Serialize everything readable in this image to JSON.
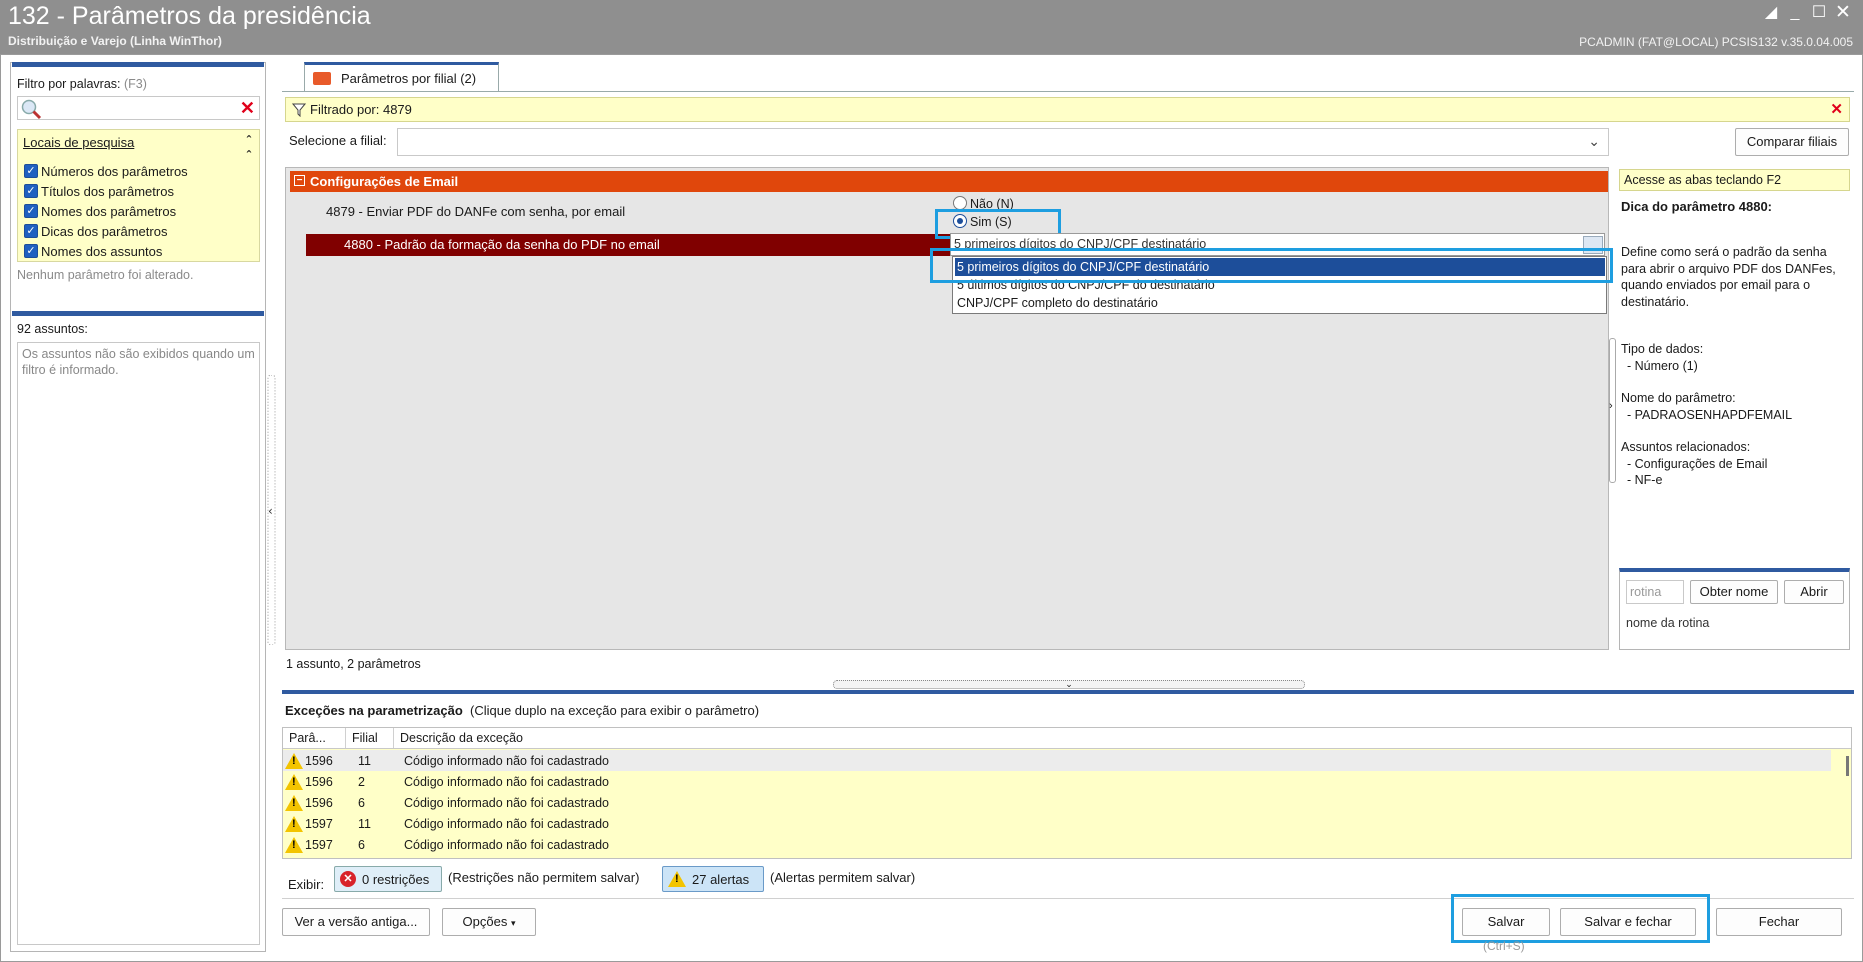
{
  "window": {
    "title": "132 - Parâmetros da presidência",
    "subtitle": "Distribuição e Varejo (Linha WinThor)",
    "user_info": "PCADMIN (FAT@LOCAL)   PCSIS132  v.35.0.04.005"
  },
  "left_panel": {
    "filter_label": "Filtro por palavras:",
    "filter_hint": "(F3)",
    "search_value": "",
    "locais_title": "Locais de pesquisa",
    "locais": [
      "Números dos parâmetros",
      "Títulos dos parâmetros",
      "Nomes dos parâmetros",
      "Dicas dos parâmetros",
      "Nomes dos assuntos"
    ],
    "no_change": "Nenhum parâmetro foi alterado.",
    "assuntos_count": "92 assuntos:",
    "assuntos_msg": "Os assuntos não são exibidos quando um filtro é informado."
  },
  "tab": {
    "label": "Parâmetros por filial  (2)"
  },
  "filter_bar": {
    "text": "Filtrado por: 4879"
  },
  "filial": {
    "label": "Selecione a filial:",
    "value": "",
    "compare_button": "Comparar filiais"
  },
  "section": {
    "title": "Configurações de Email"
  },
  "params": [
    {
      "label": "4879 - Enviar PDF do DANFe com senha, por email"
    },
    {
      "label": "4880 - Padrão da formação da senha do PDF no email"
    }
  ],
  "radio_options": {
    "nao": "Não (N)",
    "sim": "Sim (S)"
  },
  "combo": {
    "current": "5 primeiros dígitos do CNPJ/CPF destinatário",
    "options": [
      "5 primeiros dígitos do CNPJ/CPF destinatário",
      "5 últimos dígitos do CNPJ/CPF do destinatário",
      "CNPJ/CPF completo do destinatário"
    ]
  },
  "status": {
    "count": "1 assunto, 2 parâmetros"
  },
  "tips": {
    "access": "Acesse as abas teclando F2",
    "title": "Dica do parâmetro 4880:",
    "text": "Define como será o padrão da senha para abrir o arquivo PDF dos DANFes, quando enviados por email para o destinatário.",
    "tipo_label": "Tipo de dados:",
    "tipo_value": "- Número (1)",
    "nome_label": "Nome do parâmetro:",
    "nome_value": "- PADRAOSENHAPDFEMAIL",
    "assuntos_label": "Assuntos relacionados:",
    "assunto_1": "- Configurações de Email",
    "assunto_2": "- NF-e"
  },
  "routine": {
    "placeholder": "rotina",
    "obter_button": "Obter nome",
    "abrir_button": "Abrir",
    "name_label": "nome da rotina"
  },
  "exceptions": {
    "title": "Exceções na parametrização",
    "subtitle": "(Clique duplo na exceção para exibir o parâmetro)",
    "columns": [
      "Parâ...",
      "Filial",
      "Descrição da exceção"
    ],
    "rows": [
      {
        "param": "1596",
        "filial": "11",
        "desc": "Código informado não foi cadastrado"
      },
      {
        "param": "1596",
        "filial": "2",
        "desc": "Código informado não foi cadastrado"
      },
      {
        "param": "1596",
        "filial": "6",
        "desc": "Código informado não foi cadastrado"
      },
      {
        "param": "1597",
        "filial": "11",
        "desc": "Código informado não foi cadastrado"
      },
      {
        "param": "1597",
        "filial": "6",
        "desc": "Código informado não foi cadastrado"
      }
    ],
    "exibir_label": "Exibir:",
    "restricoes_button": "0 restrições",
    "restricoes_note": "(Restrições não permitem salvar)",
    "alertas_button": "27 alertas",
    "alertas_note": "(Alertas permitem salvar)"
  },
  "footer": {
    "versao_button": "Ver a versão antiga...",
    "opcoes_button": "Opções",
    "salvar_button": "Salvar",
    "salvar_fechar_button": "Salvar e fechar",
    "fechar_button": "Fechar",
    "shortcut": "(Ctrl+S)"
  },
  "colors": {
    "accent": "#2f5aa0",
    "section_header": "#e0470c",
    "selected_row": "#800000",
    "highlight": "#1e9ee0",
    "filter_bg": "#ffffc8"
  }
}
